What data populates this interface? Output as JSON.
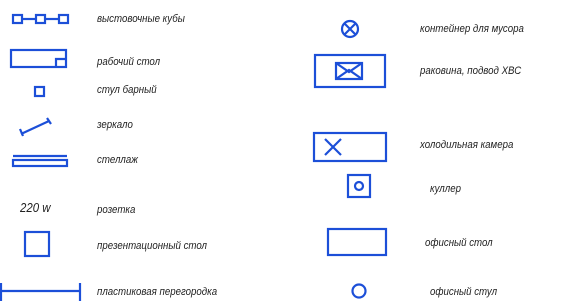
{
  "legend": {
    "symbol_color": "#1c4fd8",
    "items": [
      {
        "symbol": "three-linked-squares-icon",
        "label": "выстовочные кубы"
      },
      {
        "symbol": "rectangle-with-notch-icon",
        "label": "рабочий стол"
      },
      {
        "symbol": "small-square-icon",
        "label": "стул барный"
      },
      {
        "symbol": "diagonal-line-icon",
        "label": "зеркало"
      },
      {
        "symbol": "double-bar-icon",
        "label": "стеллаж"
      },
      {
        "symbol": "text-symbol",
        "symbol_text": "220 w",
        "label": "розетка"
      },
      {
        "symbol": "square-icon",
        "label": "презентационный стол"
      },
      {
        "symbol": "bracket-line-icon",
        "label": "пластиковая перегородка"
      },
      {
        "symbol": "circle-with-cross-icon",
        "label": "контейнер для мусора"
      },
      {
        "symbol": "rectangle-with-envelope-icon",
        "label": "раковина, подвод ХВС"
      },
      {
        "symbol": "rectangle-with-x-icon",
        "label": "холодильная камера"
      },
      {
        "symbol": "square-with-circle-icon",
        "label": "куллер"
      },
      {
        "symbol": "rectangle-icon",
        "label": "офисный стол"
      },
      {
        "symbol": "circle-icon",
        "label": "офисный стул"
      }
    ]
  }
}
